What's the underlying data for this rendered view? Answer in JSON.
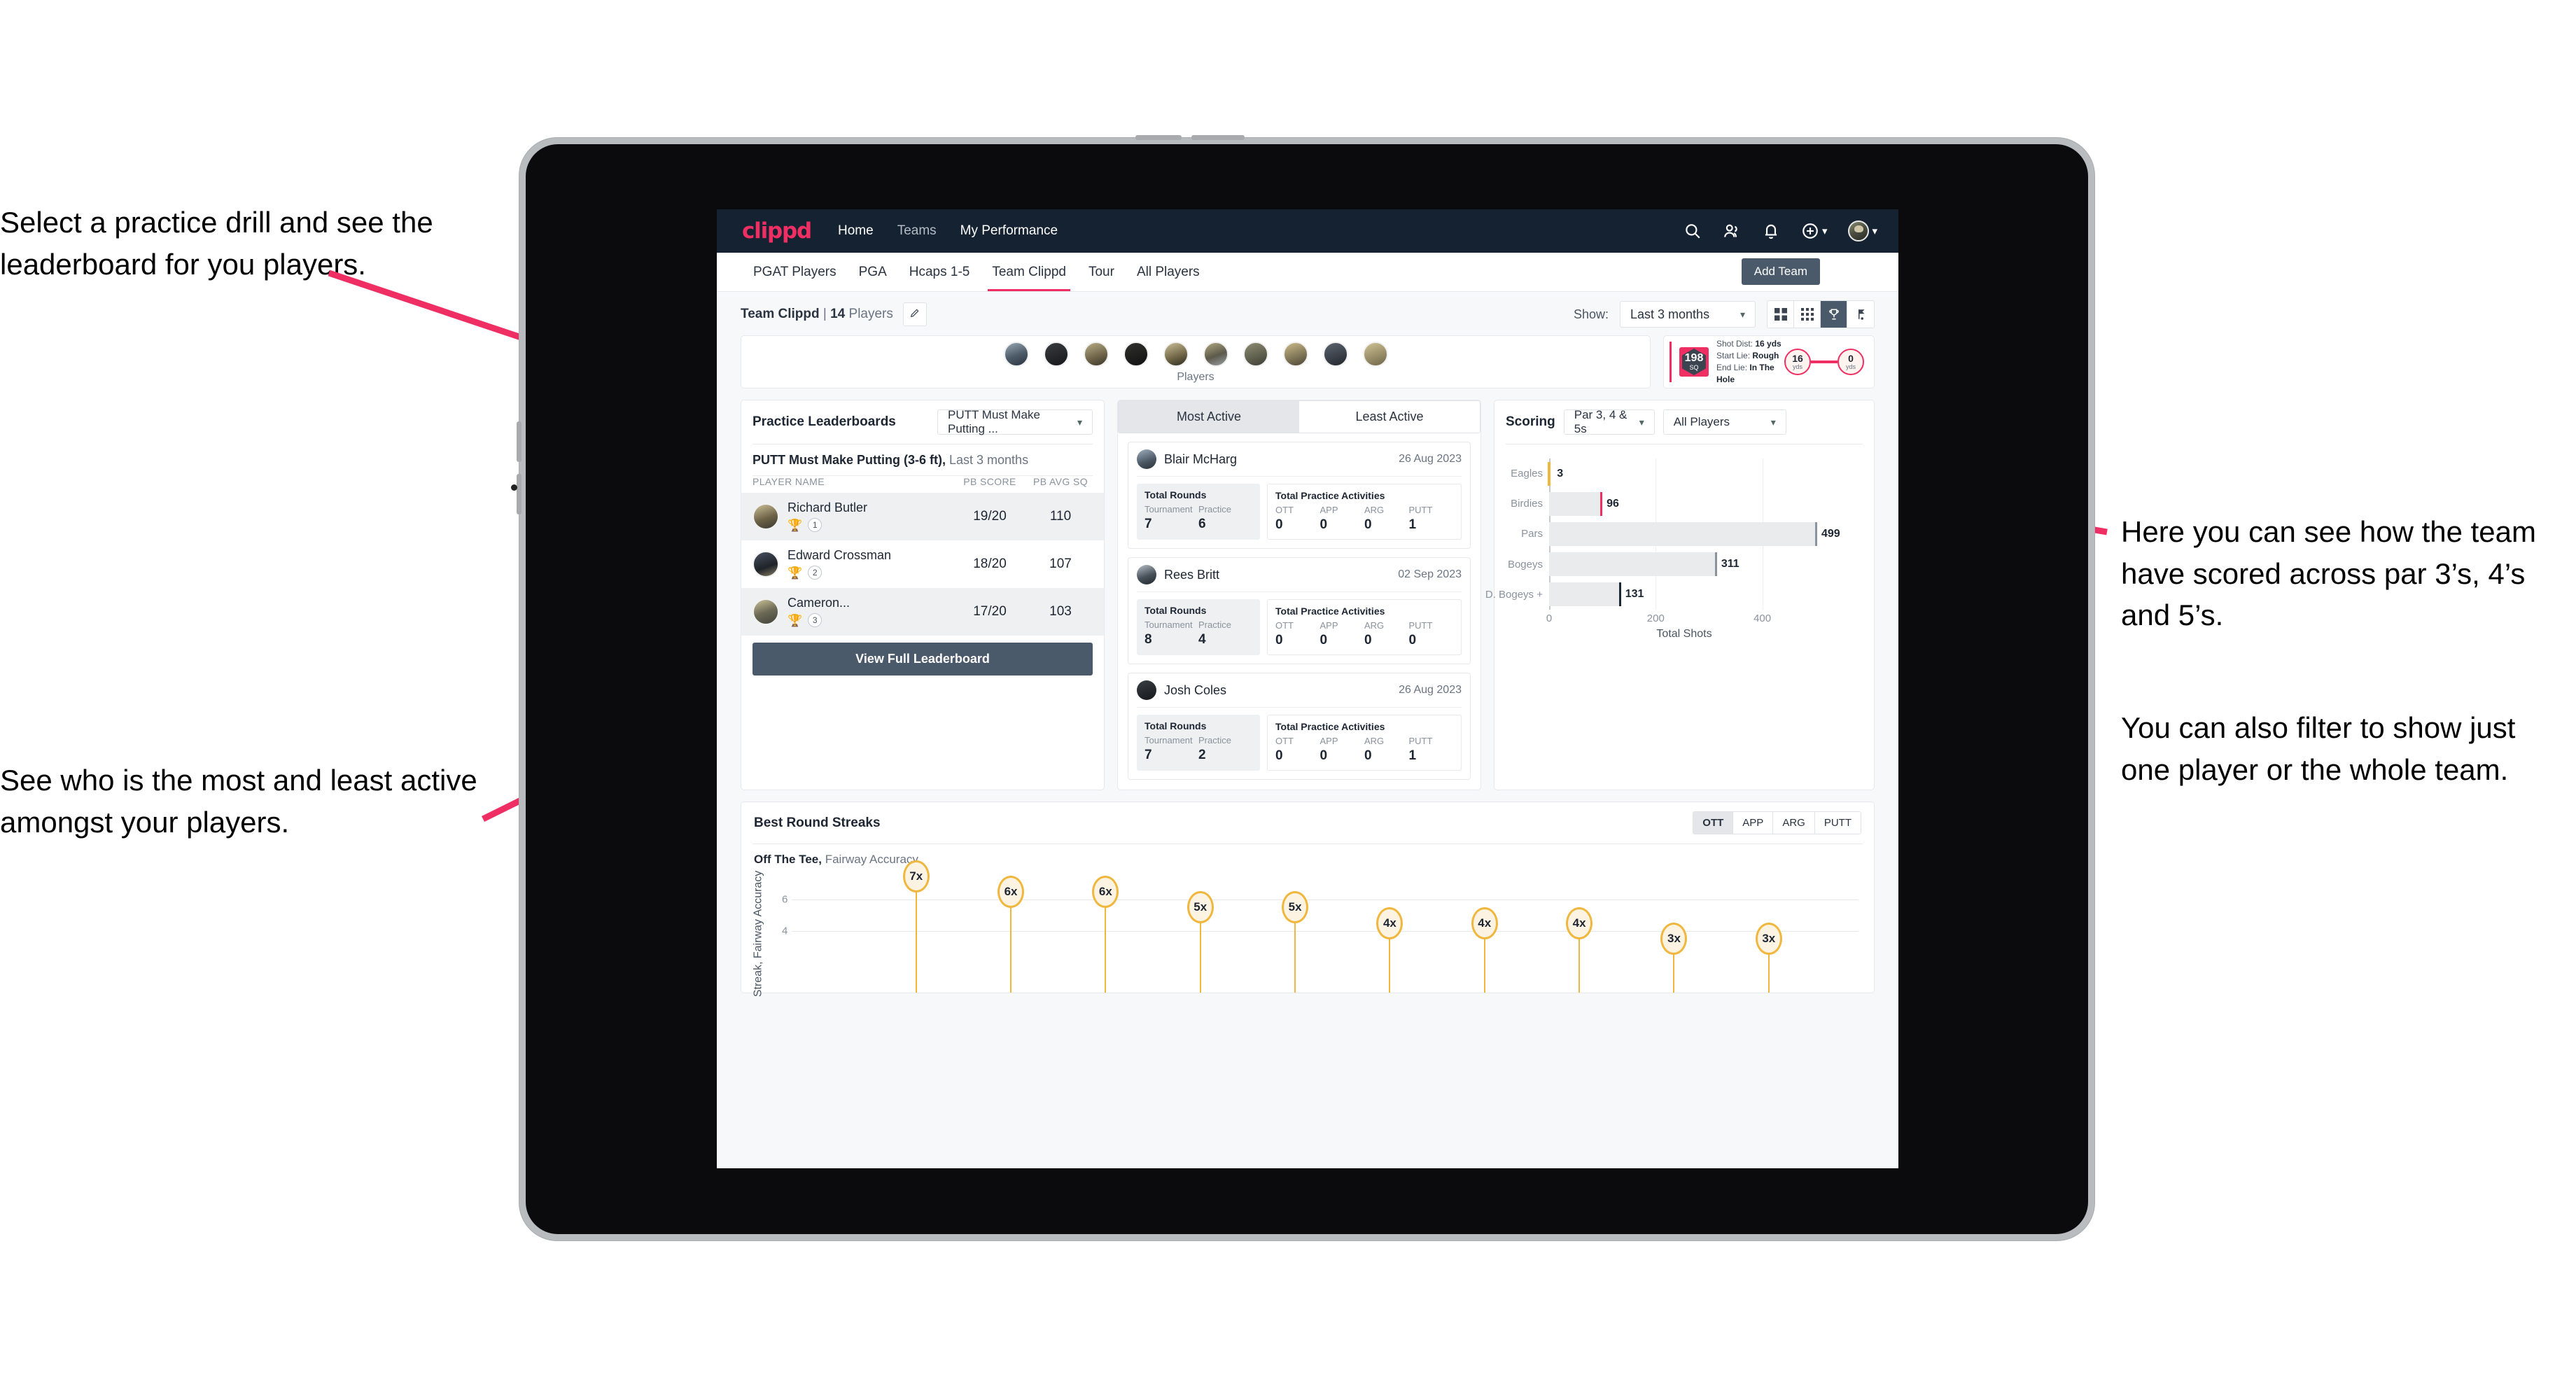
{
  "annotations": {
    "practice": "Select a practice drill and see the leaderboard for you players.",
    "active": "See who is the most and least active amongst your players.",
    "scoring": "Here you can see how the team have scored across par 3’s, 4’s and 5’s.",
    "filter": "You can also filter to show just one player or the whole team."
  },
  "navbar": {
    "logo": "clippd",
    "links": [
      "Home",
      "Teams",
      "My Performance"
    ],
    "icons": [
      "search-icon",
      "people-icon",
      "bell-icon",
      "plus-circle-icon",
      "avatar"
    ]
  },
  "tabs": {
    "items": [
      "PGAT Players",
      "PGA",
      "Hcaps 1-5",
      "Team Clippd",
      "Tour",
      "All Players"
    ],
    "active": "Team Clippd",
    "add_team_label": "Add Team"
  },
  "subheader": {
    "team_name": "Team Clippd",
    "separator": " | ",
    "player_count": "14",
    "players_word": " Players",
    "show_label": "Show:",
    "range_value": "Last 3 months",
    "view_modes": [
      "grid-view-icon",
      "dots-grid-icon",
      "trophy-icon",
      "flag-icon"
    ],
    "view_active": "trophy-icon"
  },
  "players_strip": {
    "label": "Players",
    "count": 10
  },
  "shot_card": {
    "badge_value": "198",
    "badge_unit": "SQ",
    "lines": [
      {
        "label": "Shot Dist:",
        "value": "16 yds"
      },
      {
        "label": "Start Lie:",
        "value": "Rough"
      },
      {
        "label": "End Lie:",
        "value": "In The Hole"
      }
    ],
    "start_dot": {
      "value": "16",
      "unit": "yds"
    },
    "end_dot": {
      "value": "0",
      "unit": "yds"
    }
  },
  "leaderboard": {
    "title": "Practice Leaderboards",
    "drill_select": "PUTT Must Make Putting ...",
    "subtitle_bold": "PUTT Must Make Putting (3-6 ft),",
    "subtitle_muted": " Last 3 months",
    "columns": [
      "PLAYER NAME",
      "PB SCORE",
      "PB AVG SQ"
    ],
    "rows": [
      {
        "name": "Richard Butler",
        "rank": "1",
        "trophy": "gold",
        "score": "19/20",
        "avg": "110"
      },
      {
        "name": "Edward Crossman",
        "rank": "2",
        "trophy": "silver",
        "score": "18/20",
        "avg": "107"
      },
      {
        "name": "Cameron...",
        "rank": "3",
        "trophy": "bronze",
        "score": "17/20",
        "avg": "103"
      }
    ],
    "button_label": "View Full Leaderboard"
  },
  "activity": {
    "segments": [
      "Most Active",
      "Least Active"
    ],
    "active_segment": "Most Active",
    "rounds_title": "Total Rounds",
    "rounds_labels": [
      "Tournament",
      "Practice"
    ],
    "practice_title": "Total Practice Activities",
    "practice_labels": [
      "OTT",
      "APP",
      "ARG",
      "PUTT"
    ],
    "players": [
      {
        "name": "Blair McHarg",
        "date": "26 Aug 2023",
        "tournament": "7",
        "practice": "6",
        "ott": "0",
        "app": "0",
        "arg": "0",
        "putt": "1"
      },
      {
        "name": "Rees Britt",
        "date": "02 Sep 2023",
        "tournament": "8",
        "practice": "4",
        "ott": "0",
        "app": "0",
        "arg": "0",
        "putt": "0"
      },
      {
        "name": "Josh Coles",
        "date": "26 Aug 2023",
        "tournament": "7",
        "practice": "2",
        "ott": "0",
        "app": "0",
        "arg": "0",
        "putt": "1"
      }
    ]
  },
  "scoring": {
    "title": "Scoring",
    "par_filter": "Par 3, 4 & 5s",
    "player_filter": "All Players"
  },
  "streaks": {
    "title": "Best Round Streaks",
    "segments": [
      "OTT",
      "APP",
      "ARG",
      "PUTT"
    ],
    "active_segment": "OTT",
    "subtitle_bold": "Off The Tee,",
    "subtitle_muted": " Fairway Accuracy"
  },
  "chart_data": [
    {
      "type": "bar",
      "orientation": "horizontal",
      "title": "Scoring",
      "categories": [
        "Eagles",
        "Birdies",
        "Pars",
        "Bogeys",
        "D. Bogeys +"
      ],
      "values": [
        3,
        96,
        499,
        311,
        131
      ],
      "cap_colors": [
        "#efb73e",
        "#ef2e63",
        "#8a929d",
        "#8a929d",
        "#1d2632"
      ],
      "xlabel": "Total Shots",
      "ylabel": "",
      "xticks": [
        0,
        200,
        400
      ],
      "xlim": [
        0,
        520
      ],
      "grid": true,
      "legend": "none"
    },
    {
      "type": "bar",
      "orientation": "vertical-lollipop",
      "title": "Best Round Streaks",
      "subtitle": "Off The Tee, Fairway Accuracy",
      "categories": [
        "",
        "",
        "",
        "",
        "",
        "",
        "",
        "",
        "",
        ""
      ],
      "values": [
        7,
        6,
        6,
        5,
        5,
        4,
        4,
        4,
        3,
        3
      ],
      "labels": [
        "7x",
        "6x",
        "6x",
        "5x",
        "5x",
        "4x",
        "4x",
        "4x",
        "3x",
        "3x"
      ],
      "ylabel": "Streak, Fairway Accuracy",
      "yticks": [
        4,
        6
      ],
      "ylim": [
        0,
        7.6
      ],
      "grid": true,
      "legend": "none"
    }
  ]
}
